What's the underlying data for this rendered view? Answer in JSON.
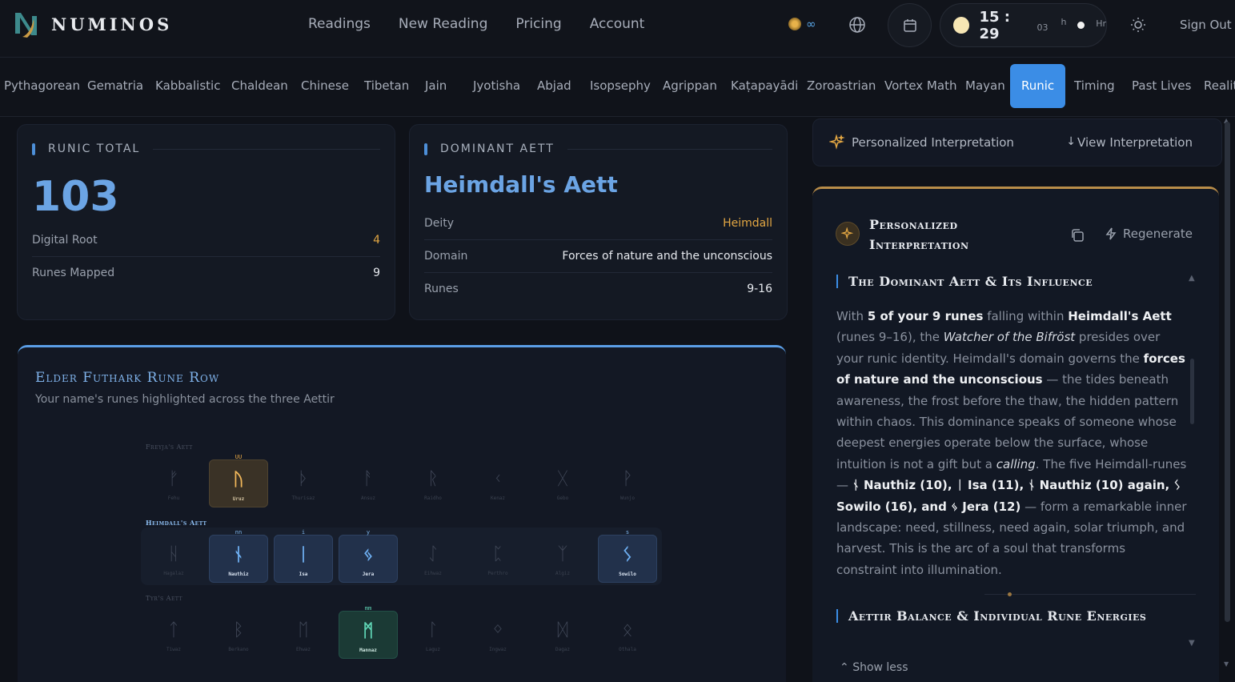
{
  "brand": {
    "name": "NUMINOS"
  },
  "nav": [
    "Readings",
    "New Reading",
    "Pricing",
    "Account"
  ],
  "header": {
    "credits": "∞",
    "clock": {
      "time": "15 : 29",
      "seconds": "03",
      "h_label": "h",
      "hr_label": "Hr"
    },
    "sign_out": "Sign Out"
  },
  "tabs": [
    "Pythagorean",
    "Gematria",
    "Kabbalistic",
    "Chaldean",
    "Chinese",
    "Tibetan",
    "Jain",
    "Jyotisha",
    "Abjad",
    "Isopsephy",
    "Agrippan",
    "Kaṭapayādi",
    "Zoroastrian",
    "Vortex Math",
    "Mayan",
    "Runic",
    "Timing",
    "Past Lives",
    "Realit"
  ],
  "active_tab": "Runic",
  "runic_total": {
    "label": "RUNIC TOTAL",
    "value": "103",
    "rows": [
      {
        "k": "Digital Root",
        "v": "4"
      },
      {
        "k": "Runes Mapped",
        "v": "9"
      }
    ]
  },
  "dominant_aett": {
    "label": "DOMINANT AETT",
    "title": "Heimdall's Aett",
    "rows": [
      {
        "k": "Deity",
        "v": "Heimdall"
      },
      {
        "k": "Domain",
        "v": "Forces of nature and the unconscious"
      },
      {
        "k": "Runes",
        "v": "9-16"
      }
    ]
  },
  "rune_row": {
    "title": "Elder Futhark Rune Row",
    "subtitle": "Your name's runes highlighted across the three Aettir",
    "aettir": [
      {
        "label": "Freyja's Aett",
        "runes": [
          {
            "glyph": "ᚠ",
            "name": "Fehu"
          },
          {
            "glyph": "ᚢ",
            "name": "Uruz",
            "mark": "UU",
            "tone": "gold"
          },
          {
            "glyph": "ᚦ",
            "name": "Thurisaz"
          },
          {
            "glyph": "ᚨ",
            "name": "Ansuz"
          },
          {
            "glyph": "ᚱ",
            "name": "Raidho"
          },
          {
            "glyph": "ᚲ",
            "name": "Kenaz"
          },
          {
            "glyph": "ᚷ",
            "name": "Gebo"
          },
          {
            "glyph": "ᚹ",
            "name": "Wunjo"
          }
        ]
      },
      {
        "label": "Heimdall's Aett",
        "highlight": true,
        "runes": [
          {
            "glyph": "ᚺ",
            "name": "Hagalaz"
          },
          {
            "glyph": "ᚾ",
            "name": "Nauthiz",
            "mark": "nn",
            "tone": "blue"
          },
          {
            "glyph": "ᛁ",
            "name": "Isa",
            "mark": "i",
            "tone": "blue"
          },
          {
            "glyph": "ᛃ",
            "name": "Jera",
            "mark": "y",
            "tone": "blue"
          },
          {
            "glyph": "ᛇ",
            "name": "Eihwaz"
          },
          {
            "glyph": "ᛈ",
            "name": "Perthro"
          },
          {
            "glyph": "ᛉ",
            "name": "Algiz"
          },
          {
            "glyph": "ᛊ",
            "name": "Sowilo",
            "mark": "s",
            "tone": "blue"
          }
        ]
      },
      {
        "label": "Tyr's Aett",
        "runes": [
          {
            "glyph": "ᛏ",
            "name": "Tiwaz"
          },
          {
            "glyph": "ᛒ",
            "name": "Berkano"
          },
          {
            "glyph": "ᛖ",
            "name": "Ehwaz"
          },
          {
            "glyph": "ᛗ",
            "name": "Mannaz",
            "mark": "mm",
            "tone": "green"
          },
          {
            "glyph": "ᛚ",
            "name": "Laguz"
          },
          {
            "glyph": "ᛜ",
            "name": "Ingwaz"
          },
          {
            "glyph": "ᛞ",
            "name": "Dagaz"
          },
          {
            "glyph": "ᛟ",
            "name": "Othala"
          }
        ]
      }
    ]
  },
  "interpretation": {
    "bar_label": "Personalized Interpretation",
    "view_label": "View Interpretation",
    "title": "Personalized Interpretation",
    "regenerate": "Regenerate",
    "section1_title": "The Dominant Aett & Its Influence",
    "section2_title": "Aettir Balance & Individual Rune Energies",
    "show_less": "Show less",
    "paragraph": [
      {
        "t": "With "
      },
      {
        "t": "5 of your 9 runes",
        "s": "b"
      },
      {
        "t": " falling within "
      },
      {
        "t": "Heimdall's Aett",
        "s": "b"
      },
      {
        "t": " (runes 9–16), the "
      },
      {
        "t": "Watcher of the Bifröst",
        "s": "i"
      },
      {
        "t": " presides over your runic identity. Heimdall's domain governs the "
      },
      {
        "t": "forces of nature and the unconscious",
        "s": "b"
      },
      {
        "t": " — the tides beneath awareness, the frost before the thaw, the hidden pattern within chaos. This dominance speaks of someone whose deepest energies operate below the surface, whose intuition is not a gift but a "
      },
      {
        "t": "calling",
        "s": "i"
      },
      {
        "t": ". The five Heimdall-runes — "
      },
      {
        "t": "ᚾ Nauthiz (10), ᛁ Isa (11), ᚾ Nauthiz (10) again, ᛊ Sowilo (16), and ᛃ Jera (12)",
        "s": "b"
      },
      {
        "t": " — form a remarkable inner landscape: need, stillness, need again, solar triumph, and harvest. This is the arc of a soul that transforms constraint into illumination."
      }
    ]
  },
  "colors": {
    "accent": "#3b8de6",
    "gold": "#e3a743",
    "heading_blue": "#6ba4e4",
    "background": "#0f1219"
  }
}
